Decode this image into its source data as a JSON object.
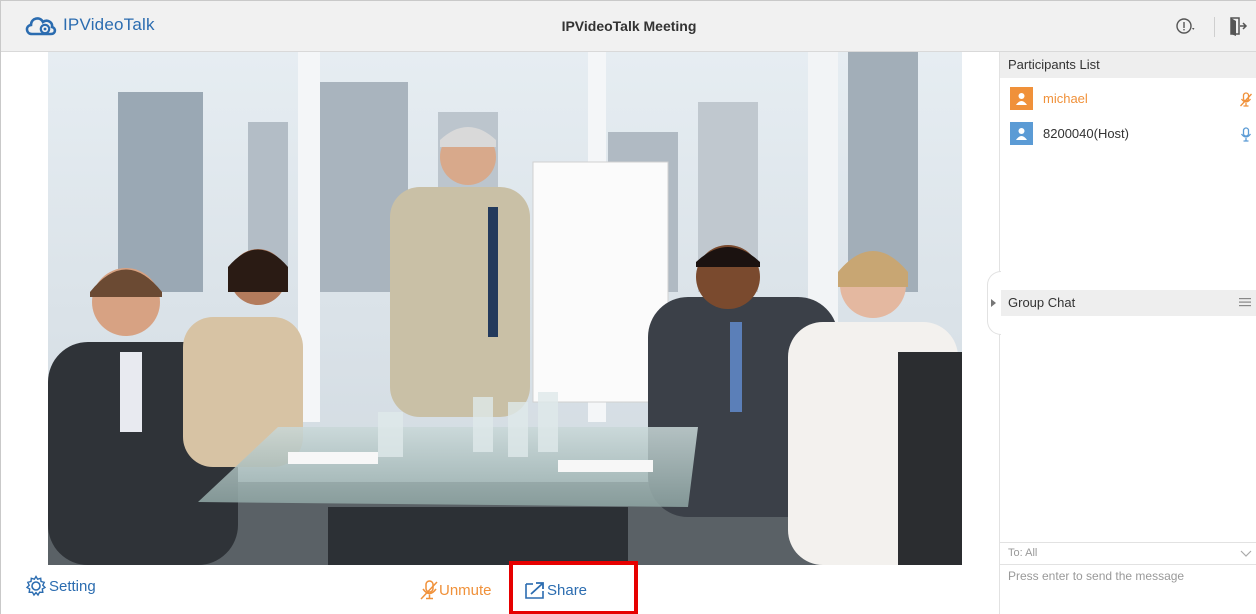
{
  "app": {
    "name": "IPVideoTalk",
    "title": "IPVideoTalk Meeting"
  },
  "participants": {
    "header": "Participants List",
    "items": [
      {
        "name": "michael",
        "color": "#f0913a",
        "mic": "muted-mic-icon"
      },
      {
        "name": "8200040(Host)",
        "color": "#5b9bd5",
        "mic": "mic-icon"
      }
    ]
  },
  "chat": {
    "header": "Group Chat",
    "to_label": "To: All",
    "placeholder": "Press enter to send the message"
  },
  "controls": {
    "setting_label": "Setting",
    "unmute_label": "Unmute",
    "share_label": "Share"
  },
  "colors": {
    "accent_blue": "#2b6cb0",
    "accent_orange": "#f0913a",
    "highlight": "#e60000"
  }
}
